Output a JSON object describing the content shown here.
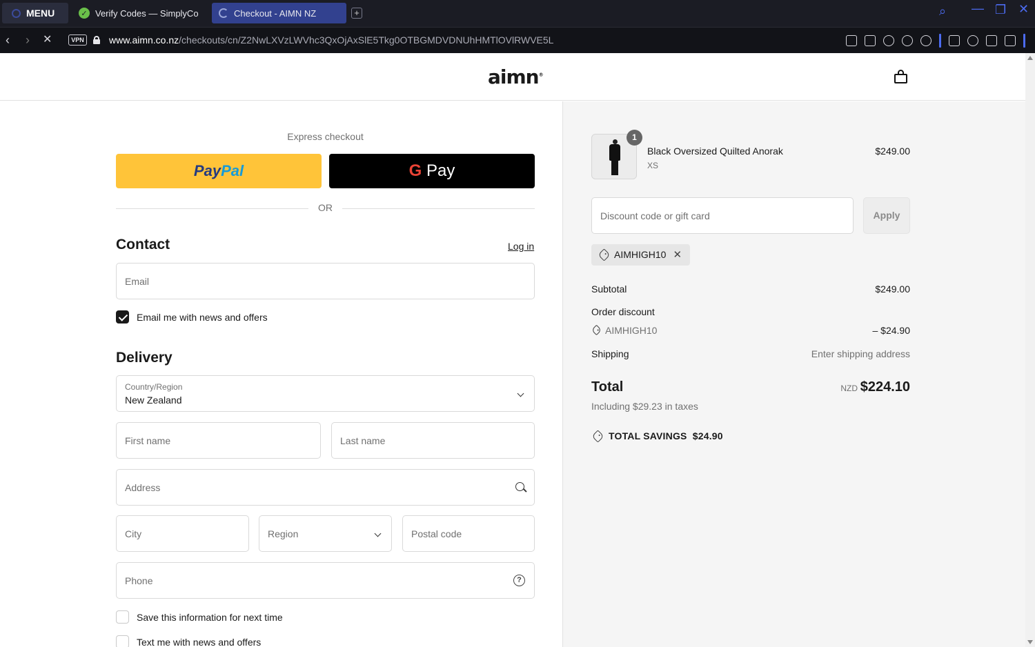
{
  "browser": {
    "menu_label": "MENU",
    "tabs": [
      {
        "title": "Verify Codes — SimplyCo"
      },
      {
        "title": "Checkout - AIMN NZ"
      }
    ],
    "new_tab": "+",
    "vpn_label": "VPN",
    "url_domain": "www.aimn.co.nz",
    "url_path": "/checkouts/cn/Z2NwLXVzLWVhc3QxOjAxSlE5Tkg0OTBGMDVDNUhHMTlOVlRWVE5L"
  },
  "header": {
    "logo": "aimn"
  },
  "express": {
    "label": "Express checkout",
    "paypal_a": "Pay",
    "paypal_b": "Pal",
    "gpay_g": "G",
    "gpay_pay": "Pay",
    "or": "OR"
  },
  "contact": {
    "title": "Contact",
    "login": "Log in",
    "email_placeholder": "Email",
    "news_checkbox": "Email me with news and offers"
  },
  "delivery": {
    "title": "Delivery",
    "country_label": "Country/Region",
    "country_value": "New Zealand",
    "first_name": "First name",
    "last_name": "Last name",
    "address": "Address",
    "city": "City",
    "region": "Region",
    "postal": "Postal code",
    "phone": "Phone",
    "save_info": "Save this information for next time",
    "text_me": "Text me with news and offers"
  },
  "summary": {
    "product": {
      "name": "Black Oversized Quilted Anorak",
      "variant": "XS",
      "price": "$249.00",
      "quantity": "1"
    },
    "discount_placeholder": "Discount code or gift card",
    "apply": "Apply",
    "applied_code": "AIMHIGH10",
    "subtotal_label": "Subtotal",
    "subtotal_value": "$249.00",
    "order_discount_label": "Order discount",
    "order_discount_code": "AIMHIGH10",
    "order_discount_value": "– $24.90",
    "shipping_label": "Shipping",
    "shipping_value": "Enter shipping address",
    "total_label": "Total",
    "total_currency": "NZD",
    "total_value": "$224.10",
    "taxes": "Including $29.23 in taxes",
    "savings": "TOTAL SAVINGS  $24.90"
  },
  "colors": {
    "paypal_yellow": "#ffc439",
    "gpay_black": "#000000",
    "summary_bg": "#f5f5f5",
    "browser_accent": "#4c6bf0"
  }
}
